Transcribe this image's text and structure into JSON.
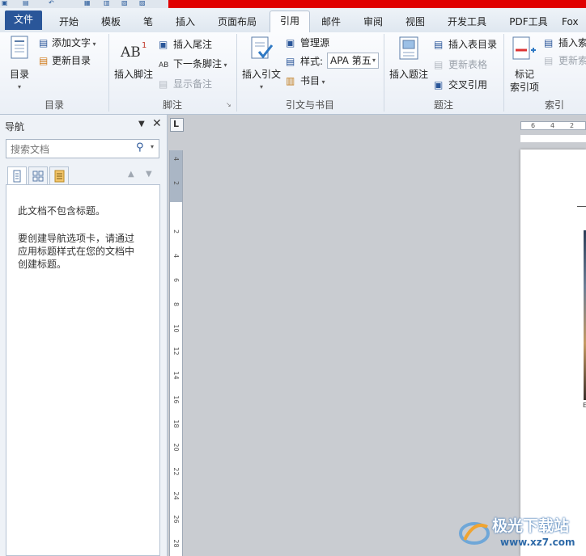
{
  "tabs": [
    {
      "label": "文件"
    },
    {
      "label": "开始"
    },
    {
      "label": "模板"
    },
    {
      "label": "笔"
    },
    {
      "label": "插入"
    },
    {
      "label": "页面布局"
    },
    {
      "label": "引用"
    },
    {
      "label": "邮件"
    },
    {
      "label": "审阅"
    },
    {
      "label": "视图"
    },
    {
      "label": "开发工具"
    },
    {
      "label": "PDF工具"
    },
    {
      "label": "Fox"
    }
  ],
  "ribbon": {
    "toc": {
      "toc_button": "目录",
      "add_text": "添加文字",
      "update_toc": "更新目录",
      "group_label": "目录"
    },
    "footnotes": {
      "insert_footnote": "插入脚注",
      "insert_endnote": "插入尾注",
      "next_footnote": "下一条脚注",
      "show_notes": "显示备注",
      "group_label": "脚注"
    },
    "citations": {
      "insert_citation": "插入引文",
      "manage_sources": "管理源",
      "style_label": "样式:",
      "style_value": "APA 第五",
      "bibliography": "书目",
      "group_label": "引文与书目"
    },
    "captions": {
      "insert_caption": "插入题注",
      "insert_table_of_figures": "插入表目录",
      "update_table": "更新表格",
      "cross_reference": "交叉引用",
      "group_label": "题注"
    },
    "index": {
      "mark_entry_line1": "标记",
      "mark_entry_line2": "索引项",
      "insert_index": "插入索",
      "update_index": "更新索",
      "group_label": "索引"
    }
  },
  "nav": {
    "title": "导航",
    "search_placeholder": "搜索文档",
    "message_line1": "此文档不包含标题。",
    "message_line2": "要创建导航选项卡，请通过",
    "message_line3": "应用标题样式在您的文档中",
    "message_line4": "创建标题。"
  },
  "ruler": {
    "vertical_numbers": [
      "4",
      "2",
      "2",
      "4",
      "6",
      "8",
      "10",
      "12",
      "14",
      "16",
      "18",
      "20",
      "22",
      "24",
      "26",
      "28"
    ],
    "horizontal_numbers": [
      "6",
      "4",
      "2"
    ]
  },
  "watermark": {
    "brand": "极光下载站",
    "url": "www.xz7.com"
  },
  "colors": {
    "file_tab": "#2a5699",
    "title_accent": "#e00000",
    "ribbon_bg": "#f3f6fa"
  }
}
